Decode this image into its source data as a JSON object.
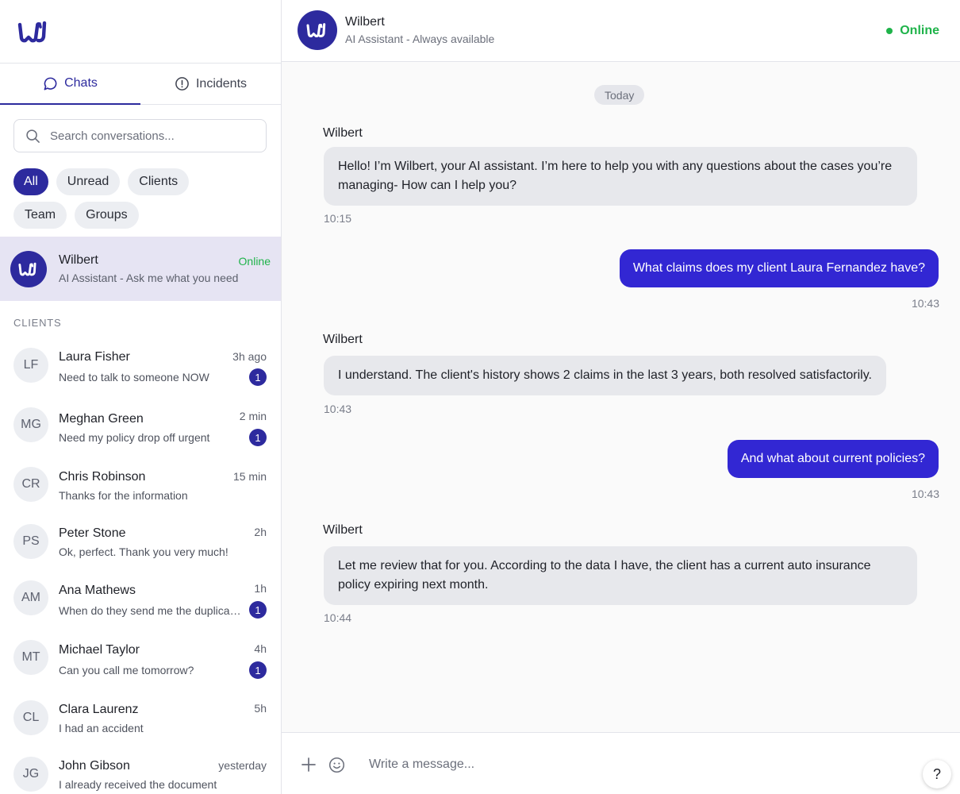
{
  "brand": {
    "icon": "wilbert-logo-icon",
    "color": "#2d2a9e"
  },
  "tabs": [
    {
      "label": "Chats",
      "icon": "chat-bubble-icon",
      "active": true
    },
    {
      "label": "Incidents",
      "icon": "alert-circle-icon",
      "active": false
    }
  ],
  "search": {
    "placeholder": "Search conversations...",
    "value": ""
  },
  "filters": [
    {
      "label": "All",
      "active": true
    },
    {
      "label": "Unread",
      "active": false
    },
    {
      "label": "Clients",
      "active": false
    },
    {
      "label": "Team",
      "active": false
    },
    {
      "label": "Groups",
      "active": false
    }
  ],
  "pinned": {
    "name": "Wilbert",
    "subtitle": "AI Assistant - Ask me what you need",
    "status": "Online"
  },
  "clients_section": {
    "label": "CLIENTS"
  },
  "contacts": [
    {
      "initials": "LF",
      "name": "Laura Fisher",
      "message": "Need to talk to someone NOW",
      "time": "3h ago",
      "unread": "1"
    },
    {
      "initials": "MG",
      "name": "Meghan Green",
      "message": "Need my policy drop off urgent",
      "time": "2 min",
      "unread": "1"
    },
    {
      "initials": "CR",
      "name": "Chris Robinson",
      "message": "Thanks for the information",
      "time": "15 min",
      "unread": ""
    },
    {
      "initials": "PS",
      "name": "Peter Stone",
      "message": "Ok, perfect. Thank you very much!",
      "time": "2h",
      "unread": ""
    },
    {
      "initials": "AM",
      "name": "Ana Mathews",
      "message": "When do they send me the duplicate of my policy?",
      "time": "1h",
      "unread": "1"
    },
    {
      "initials": "MT",
      "name": "Michael Taylor",
      "message": "Can you call me tomorrow?",
      "time": "4h",
      "unread": "1"
    },
    {
      "initials": "CL",
      "name": "Clara Laurenz",
      "message": "I had an accident",
      "time": "5h",
      "unread": ""
    },
    {
      "initials": "JG",
      "name": "John Gibson",
      "message": "I already received the document",
      "time": "yesterday",
      "unread": ""
    }
  ],
  "chat": {
    "header": {
      "name": "Wilbert",
      "subtitle": "AI Assistant - Always available",
      "status": "Online",
      "status_color": "#1fb34a"
    },
    "day_label": "Today",
    "messages": [
      {
        "from": "bot",
        "sender": "Wilbert",
        "text": "Hello! I’m Wilbert, your AI assistant. I’m here to help you with any questions about the cases you’re managing- How can I help you?",
        "time": "10:15"
      },
      {
        "from": "user",
        "text": "What claims does my client Laura Fernandez have?",
        "time": "10:43"
      },
      {
        "from": "bot",
        "sender": "Wilbert",
        "text": "I understand. The client's history shows 2 claims in the last 3 years, both resolved satisfactorily.",
        "time": "10:43"
      },
      {
        "from": "user",
        "text": "And what about current policies?",
        "time": "10:43"
      },
      {
        "from": "bot",
        "sender": "Wilbert",
        "text": "Let me review that for you. According to the data I have, the client has a current auto insurance policy expiring next month.",
        "time": "10:44"
      }
    ],
    "composer": {
      "placeholder": "Write a message...",
      "value": "",
      "attach_icon": "plus-icon",
      "emoji_icon": "emoji-icon",
      "help_label": "?"
    }
  },
  "colors": {
    "primary": "#2d2a9e",
    "outgoing_bubble": "#3227d3",
    "online": "#1fb34a",
    "selected_row": "#e6e4f3"
  }
}
